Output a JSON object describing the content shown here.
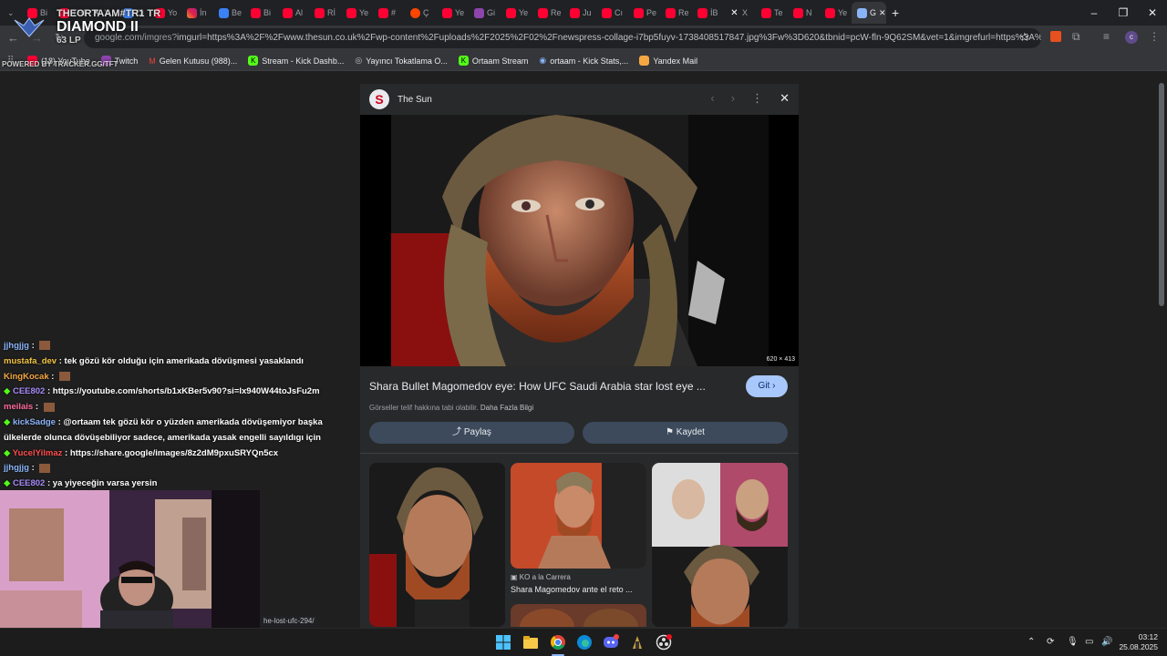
{
  "tabs": [
    "",
    "Bi",
    "THEORTAAM#TR1 TR",
    "X",
    "Cı",
    "Yo",
    "İn",
    "Be",
    "Bi",
    "Al",
    "Rİ",
    "Ye",
    "#",
    "Ç",
    "Ye",
    "Gi",
    "Ye",
    "Re",
    "Ju",
    "Cı",
    "Pe",
    "Re",
    "İB",
    "X",
    "Te",
    "N",
    "Ye",
    "G"
  ],
  "overlay": {
    "rank_name": "THEORTAAM#TR1 TR",
    "rank": "DIAMOND II",
    "lp": "63 LP",
    "powered": "POWERED BY TRACKER.GG/TFT"
  },
  "address": {
    "host": "google.com/imgres?",
    "rest": "imgurl=https%3A%2F%2Fwww.thesun.co.uk%2Fwp-content%2Fuploads%2F2025%2F02%2Fnewspress-collage-i7bp5fuyv-1738408517847.jpg%3Fw%3D620&tbnid=pcW-fln-9Q62SM&vet=1&imgrefurl=https%3A%2F%2Fw..."
  },
  "bookmarks": [
    "(18) YouTube",
    "Twitch",
    "Gelen Kutusu (988)...",
    "Stream - Kick Dashb...",
    "Yayıncı Tokatlama O...",
    "Ortaam Stream",
    "ortaam - Kick Stats,...",
    "Yandex Mail"
  ],
  "panel": {
    "source": "The Sun",
    "dims": "620 × 413",
    "title": "Shara Bullet Magomedov eye: How UFC Saudi Arabia star lost eye ...",
    "visit": "Git",
    "copyright": "Görseller telif hakkına tabi olabilir.",
    "more_info": "Daha Fazla Bilgi",
    "share": "Paylaş",
    "save": "Kaydet",
    "related_source": "KO a la Carrera",
    "related_caption": "Shara Magomedov ante el reto ..."
  },
  "chat": [
    {
      "user": "jjhgjjg",
      "color": "#8ab4f8",
      "text": ""
    },
    {
      "user": "mustafa_dev",
      "color": "#f5c542",
      "text": "tek gözü kör olduğu için amerikada dövüşmesi yasaklandı"
    },
    {
      "user": "KingKocak",
      "color": "#f5a742",
      "text": ""
    },
    {
      "user": "CEE802",
      "color": "#a78bfa",
      "text": "https://youtube.com/shorts/b1xKBer5v90?si=lx940W44toJsFu2m"
    },
    {
      "user": "meilais",
      "color": "#ff6b9d",
      "text": ""
    },
    {
      "user": "kickSadge",
      "color": "#8ab4f8",
      "text": "@ortaam tek gözü kör o yüzden amerikada dövüşemiyor başka"
    },
    {
      "user": "",
      "color": "#fff",
      "text": "ülkelerde olunca dövüşebiliyor sadece, amerikada yasak engelli sayıldıgı için"
    },
    {
      "user": "YucelYilmaz",
      "color": "#ff4d4d",
      "text": "https://share.google/images/8z2dM9pxuSRYQn5cx"
    },
    {
      "user": "jjhgjjg",
      "color": "#8ab4f8",
      "text": ""
    },
    {
      "user": "CEE802",
      "color": "#a78bfa",
      "text": "ya yiyeceğin varsa yersin"
    }
  ],
  "status_url": "he-lost-ufc-294/",
  "clock": {
    "time": "03:12",
    "date": "25.08.2025"
  }
}
